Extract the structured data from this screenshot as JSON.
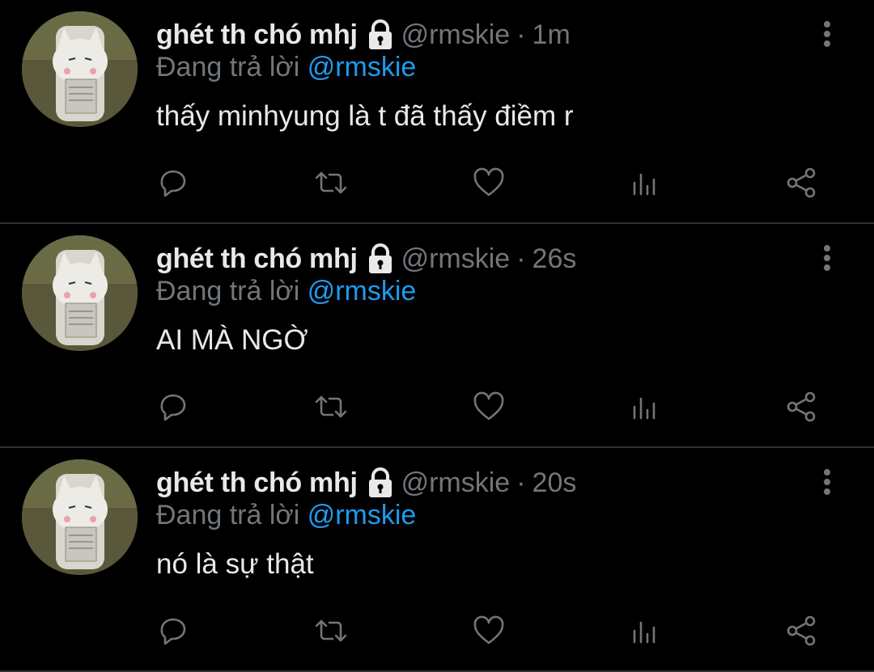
{
  "colors": {
    "background": "#000000",
    "text": "#e7e9ea",
    "muted": "#71767b",
    "accent": "#1d9bf0",
    "divider": "#2f3336"
  },
  "icons": {
    "lock": "lock-icon",
    "more": "more-vertical-icon",
    "reply": "reply-icon",
    "retweet": "retweet-icon",
    "like": "heart-icon",
    "stats": "analytics-icon",
    "share": "share-icon"
  },
  "tweets": [
    {
      "name": "ghét th chó mhj",
      "handle": "@rmskie",
      "separator": "·",
      "time": "1m",
      "reply_prefix": "Đang trả lời",
      "reply_to": "@rmskie",
      "text": "thấy minhyung là t đã thấy điềm r"
    },
    {
      "name": "ghét th chó mhj",
      "handle": "@rmskie",
      "separator": "·",
      "time": "26s",
      "reply_prefix": "Đang trả lời",
      "reply_to": "@rmskie",
      "text": "AI MÀ NGỜ"
    },
    {
      "name": "ghét th chó mhj",
      "handle": "@rmskie",
      "separator": "·",
      "time": "20s",
      "reply_prefix": "Đang trả lời",
      "reply_to": "@rmskie",
      "text": "nó là sự thật"
    }
  ]
}
